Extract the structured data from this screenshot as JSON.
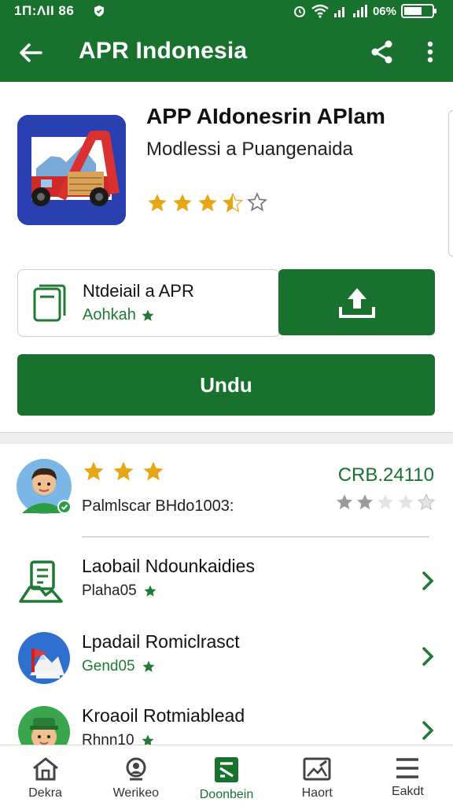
{
  "status_bar": {
    "time": "1Π:ΛΙΙ 86",
    "battery": "06%"
  },
  "app_bar": {
    "title": "APR Indonesia",
    "icons": [
      "back-arrow-icon",
      "share-icon",
      "more-vert-icon"
    ]
  },
  "app": {
    "name": "APP AIdonesrin APlam",
    "developer": "Modlessi a Puangenaida",
    "rating_stars": 3.5,
    "accent_color": "#18722e"
  },
  "file": {
    "name": "Ntdeiail a APR",
    "sub": "Aohkah"
  },
  "download_label": "Undu",
  "review": {
    "reviewer": "Palmlscar BHdo1003:",
    "score": "CRB.24110",
    "stars_gold": 3,
    "stars_gray_rating": 2
  },
  "list": [
    {
      "title": "Laobail Ndounkaidies",
      "sub": "Plaha05",
      "icon": "document-hand-icon"
    },
    {
      "title": "Lpadail Romiclrasct",
      "sub": "Gend05",
      "icon": "mountain-flag-icon"
    },
    {
      "title": "Kroaoil Rotmiablead",
      "sub": "Rhnn10",
      "icon": "person-hat-icon"
    }
  ],
  "bottom_nav": [
    {
      "label": "Dekra",
      "icon": "home-icon"
    },
    {
      "label": "Werikeo",
      "icon": "search-person-icon"
    },
    {
      "label": "Doonbein",
      "icon": "download-tab-icon"
    },
    {
      "label": "Haort",
      "icon": "image-edit-icon"
    },
    {
      "label": "Eakdt",
      "icon": "menu-icon"
    }
  ]
}
